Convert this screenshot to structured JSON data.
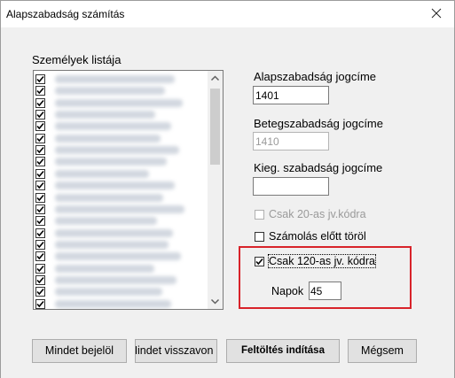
{
  "window": {
    "title": "Alapszabadság számítás"
  },
  "persons": {
    "label": "Személyek listája",
    "items": [
      {
        "checked": true,
        "w": 0
      },
      {
        "checked": true,
        "w": 0
      },
      {
        "checked": true,
        "w": 0
      },
      {
        "checked": true,
        "w": 0
      },
      {
        "checked": true,
        "w": 0
      },
      {
        "checked": true,
        "w": 0
      },
      {
        "checked": true,
        "w": 0
      },
      {
        "checked": true,
        "w": 0
      },
      {
        "checked": true,
        "w": 0
      },
      {
        "checked": true,
        "w": 0
      },
      {
        "checked": true,
        "w": 0
      },
      {
        "checked": true,
        "w": 0
      },
      {
        "checked": true,
        "w": 0
      },
      {
        "checked": true,
        "w": 0
      },
      {
        "checked": true,
        "w": 0
      },
      {
        "checked": true,
        "w": 0
      },
      {
        "checked": true,
        "w": 0
      },
      {
        "checked": true,
        "w": 0
      },
      {
        "checked": true,
        "w": 0
      },
      {
        "checked": true,
        "w": 0
      }
    ]
  },
  "fields": {
    "base_label": "Alapszabadság jogcíme",
    "base_value": "1401",
    "sick_label": "Betegszabadság jogcíme",
    "sick_value": "1410",
    "extra_label": "Kieg. szabadság jogcíme",
    "extra_value": ""
  },
  "options": {
    "only20_label": "Csak 20-as jv.kódra",
    "only20_checked": false,
    "delete_before_label": "Számolás előtt töröl",
    "delete_before_checked": false,
    "only120_label": "Csak 120-as jv. kódra",
    "only120_checked": true,
    "days_label": "Napok",
    "days_value": "45"
  },
  "buttons": {
    "select_all": "Mindet bejelöl",
    "deselect_all": "Mindet visszavon",
    "start_upload": "Feltöltés indítása",
    "cancel": "Mégsem"
  },
  "colors": {
    "highlight": "#d8232a"
  }
}
